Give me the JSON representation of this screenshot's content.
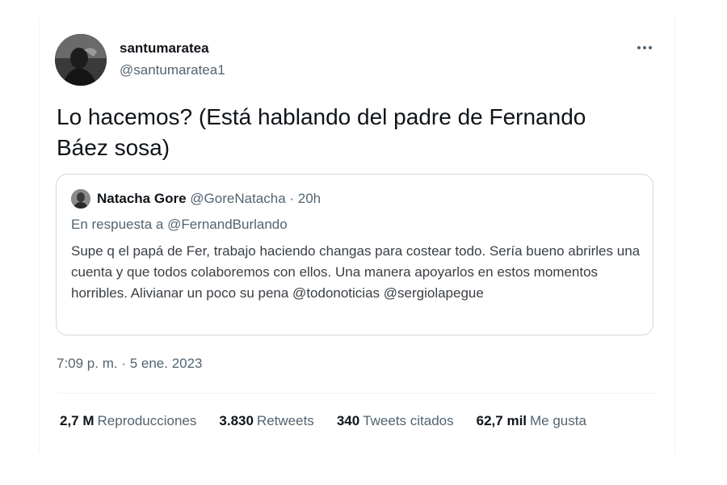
{
  "tweet": {
    "author_name": "santumaratea",
    "author_handle": "@santumaratea1",
    "text": "Lo hacemos? (Está hablando del padre de Fernando Báez sosa)",
    "timestamp": "7:09 p. m. · 5 ene. 2023"
  },
  "quoted": {
    "name": "Natacha Gore",
    "meta": "@GoreNatacha · 20h",
    "reply_prefix": "En respuesta a",
    "reply_mention": "@FernandBurlando",
    "body": "Supe q el papá de Fer, trabajo haciendo changas para costear todo. Sería bueno abrirles una cuenta y que todos colaboremos con ellos. Una manera apoyarlos en estos momentos horribles. Alivianar un poco su pena @todonoticias @sergiolapegue"
  },
  "stats": [
    {
      "num": "2,7 M",
      "label": "Reproducciones"
    },
    {
      "num": "3.830",
      "label": "Retweets"
    },
    {
      "num": "340",
      "label": "Tweets citados"
    },
    {
      "num": "62,7 mil",
      "label": "Me gusta"
    }
  ],
  "icons": {
    "more": "more-horizontal-icon"
  }
}
